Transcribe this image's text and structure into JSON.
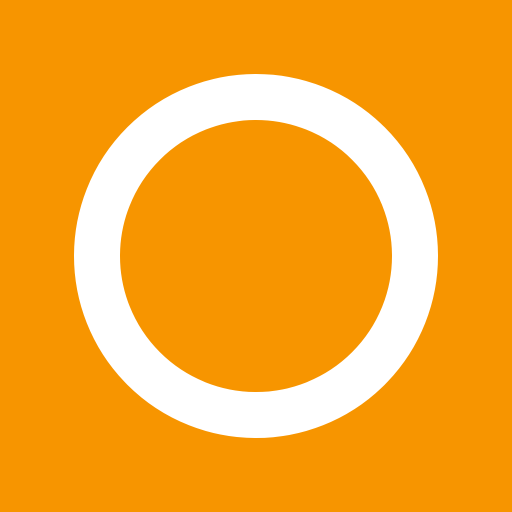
{
  "colors": {
    "background": "#F79500",
    "ring": "#FFFFFF"
  },
  "icon": {
    "name": "circle-outline-icon"
  }
}
